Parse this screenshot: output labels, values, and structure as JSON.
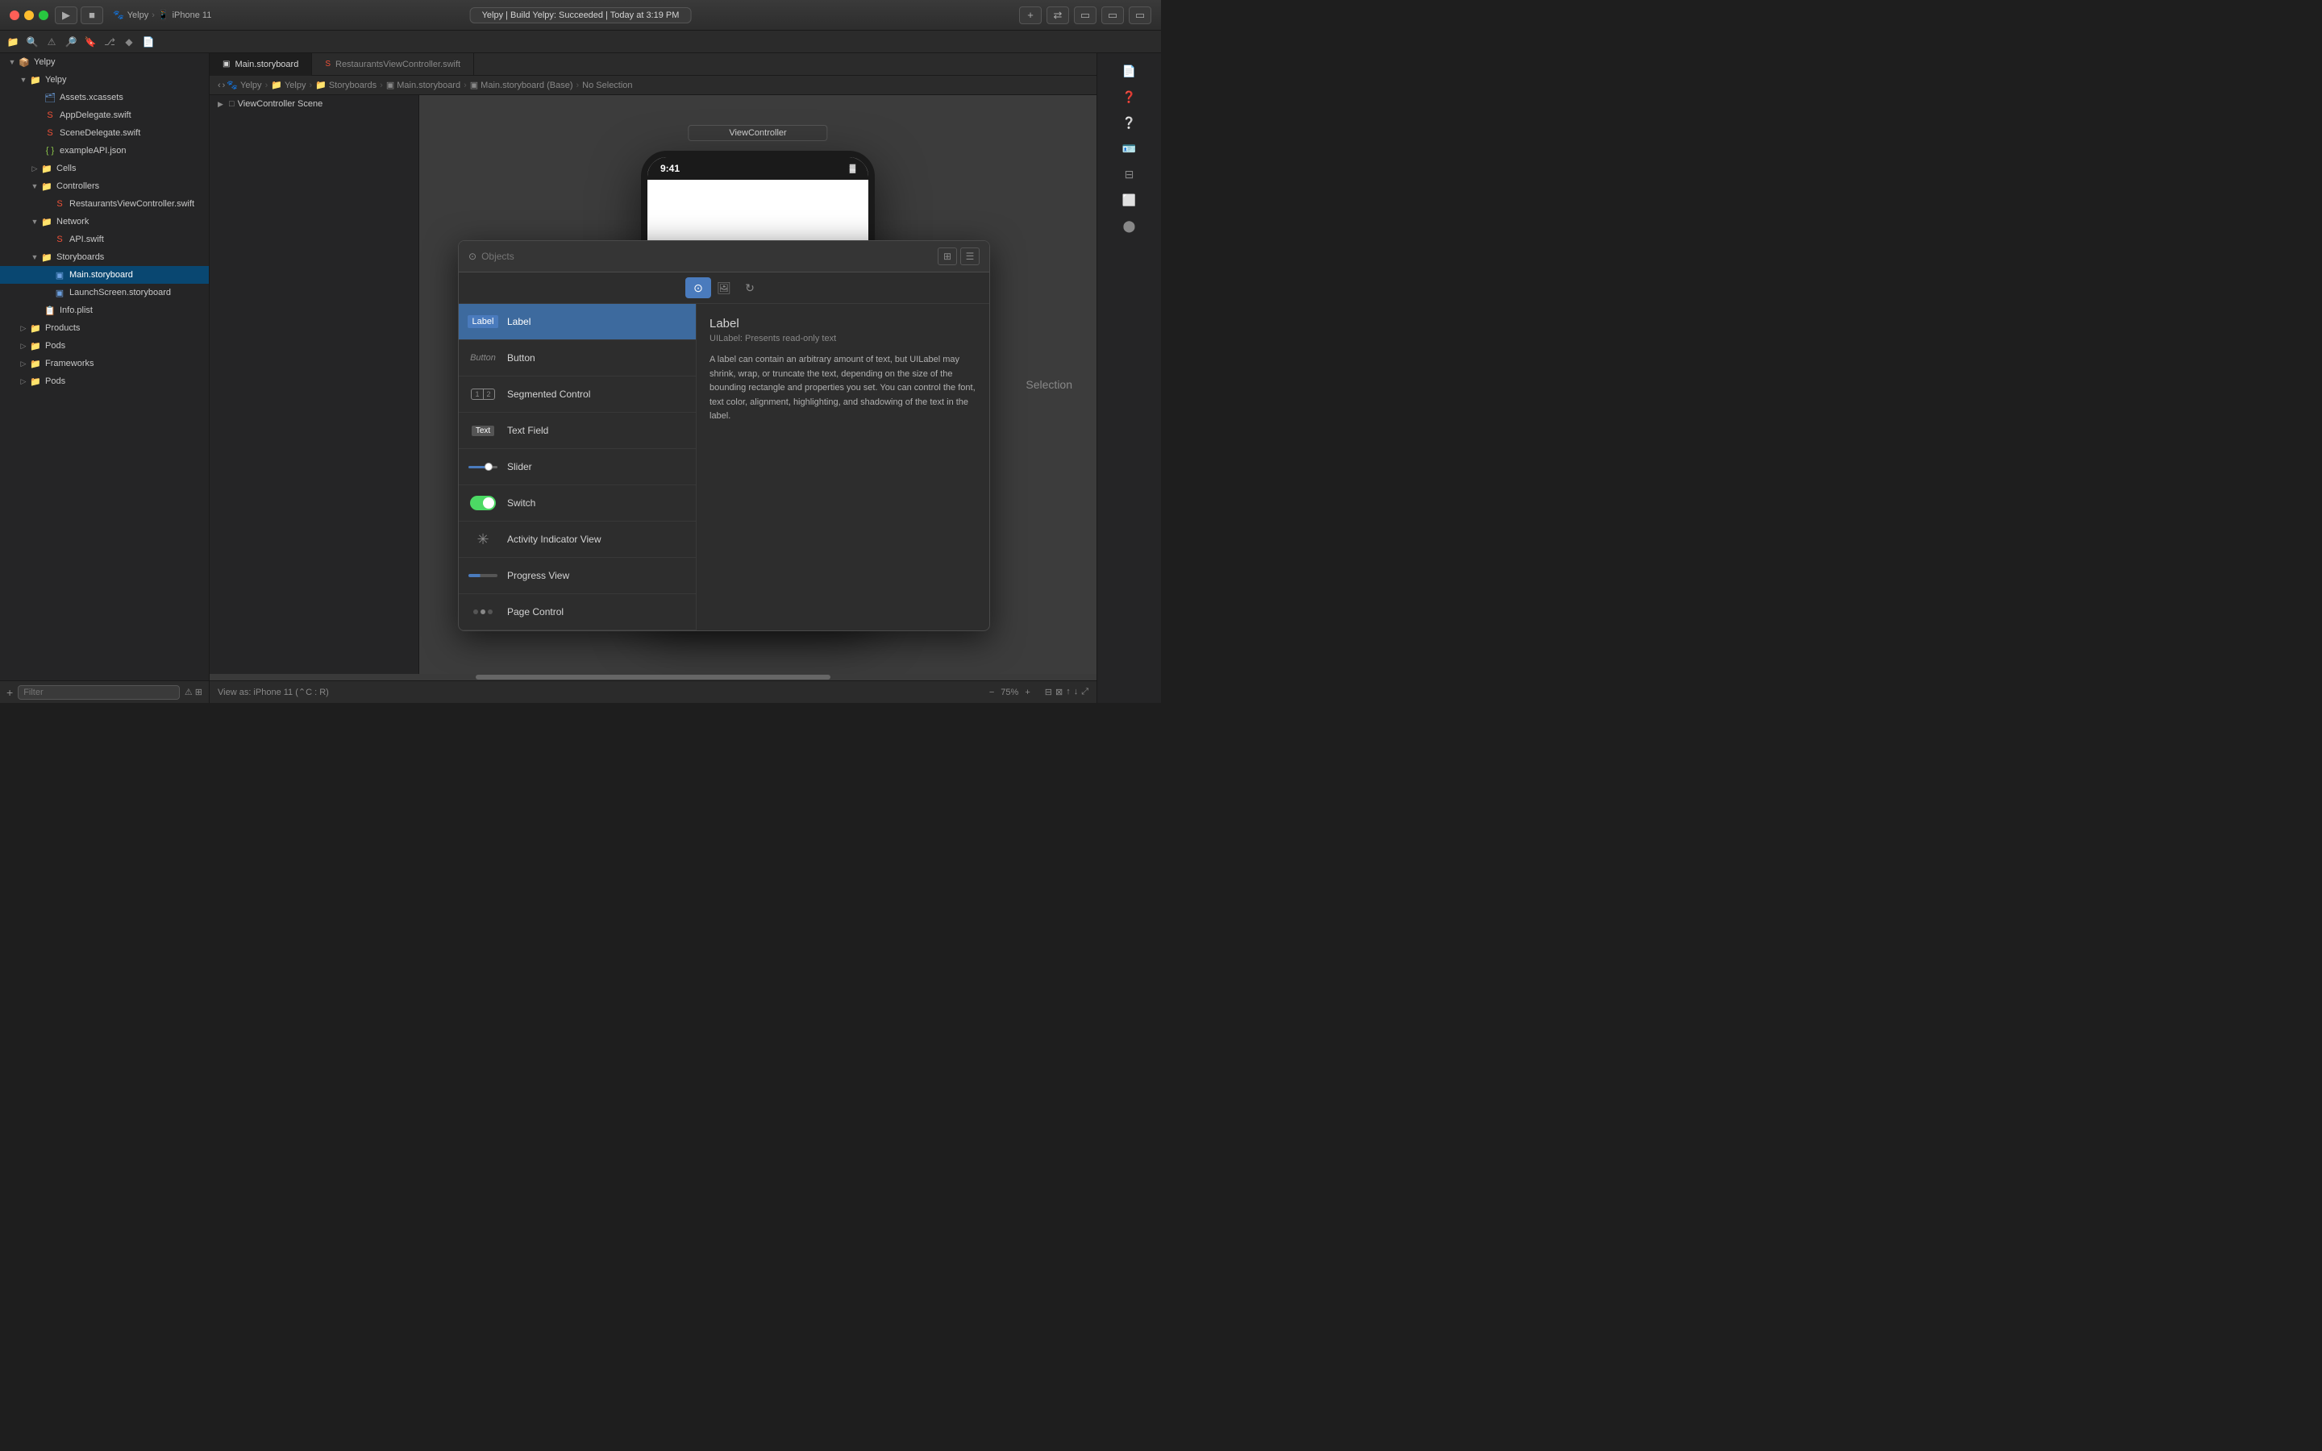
{
  "titleBar": {
    "appName": "Yelpy",
    "deviceName": "iPhone 11",
    "buildStatus": "Yelpy | Build Yelpy: Succeeded | Today at 3:19 PM"
  },
  "tabs": [
    {
      "id": "main-storyboard",
      "label": "Main.storyboard",
      "active": true
    },
    {
      "id": "restaurants-vc",
      "label": "RestaurantsViewController.swift",
      "active": false
    }
  ],
  "breadcrumb": {
    "items": [
      "Yelpy",
      "Yelpy",
      "Storyboards",
      "Main.storyboard",
      "Main.storyboard (Base)",
      "No Selection"
    ]
  },
  "sidebar": {
    "filterPlaceholder": "Filter",
    "items": [
      {
        "id": "yelpy-root",
        "label": "Yelpy",
        "type": "root",
        "indent": 0,
        "expanded": true
      },
      {
        "id": "yelpy-group",
        "label": "Yelpy",
        "type": "group",
        "indent": 1,
        "expanded": true
      },
      {
        "id": "assets",
        "label": "Assets.xcassets",
        "type": "file",
        "indent": 2
      },
      {
        "id": "appdelegate",
        "label": "AppDelegate.swift",
        "type": "swift",
        "indent": 2
      },
      {
        "id": "scenedelegate",
        "label": "SceneDelegate.swift",
        "type": "swift",
        "indent": 2
      },
      {
        "id": "exampleapi",
        "label": "exampleAPI.json",
        "type": "json",
        "indent": 2
      },
      {
        "id": "cells",
        "label": "Cells",
        "type": "group",
        "indent": 2,
        "expanded": false
      },
      {
        "id": "controllers",
        "label": "Controllers",
        "type": "group",
        "indent": 2,
        "expanded": true
      },
      {
        "id": "restaurants-vc-file",
        "label": "RestaurantsViewController.swift",
        "type": "swift",
        "indent": 3
      },
      {
        "id": "network",
        "label": "Network",
        "type": "group",
        "indent": 2,
        "expanded": true
      },
      {
        "id": "api",
        "label": "API.swift",
        "type": "swift",
        "indent": 3
      },
      {
        "id": "storyboards",
        "label": "Storyboards",
        "type": "group",
        "indent": 2,
        "expanded": true
      },
      {
        "id": "main-storyboard-file",
        "label": "Main.storyboard",
        "type": "storyboard",
        "indent": 3,
        "selected": true
      },
      {
        "id": "launchscreen",
        "label": "LaunchScreen.storyboard",
        "type": "storyboard",
        "indent": 3
      },
      {
        "id": "infoplist",
        "label": "Info.plist",
        "type": "plist",
        "indent": 2
      },
      {
        "id": "products",
        "label": "Products",
        "type": "group",
        "indent": 1,
        "expanded": false
      },
      {
        "id": "pods",
        "label": "Pods",
        "type": "group",
        "indent": 1,
        "expanded": false
      },
      {
        "id": "frameworks",
        "label": "Frameworks",
        "type": "group",
        "indent": 1,
        "expanded": false
      },
      {
        "id": "pods2",
        "label": "Pods",
        "type": "group",
        "indent": 1,
        "expanded": false
      }
    ]
  },
  "sceneOutline": {
    "items": [
      {
        "id": "scene",
        "label": "ViewController Scene",
        "indent": 0,
        "expanded": true,
        "arrow": "▶"
      }
    ]
  },
  "canvas": {
    "deviceLabel": "ViewController",
    "deviceTime": "9:41",
    "zoomLabel": "View as: iPhone 11 (⌃C : R)",
    "zoomLevel": "75%"
  },
  "objectsPanel": {
    "searchPlaceholder": "Objects",
    "tabs": [
      {
        "id": "objects",
        "icon": "⊙",
        "active": true
      },
      {
        "id": "images",
        "icon": "🖼",
        "active": false
      },
      {
        "id": "color",
        "icon": "↻",
        "active": false
      }
    ],
    "items": [
      {
        "id": "label",
        "name": "Label",
        "iconType": "label",
        "selected": true
      },
      {
        "id": "button",
        "name": "Button",
        "iconType": "button"
      },
      {
        "id": "segmented",
        "name": "Segmented Control",
        "iconType": "segmented"
      },
      {
        "id": "textfield",
        "name": "Text Field",
        "iconType": "textfield"
      },
      {
        "id": "slider",
        "name": "Slider",
        "iconType": "slider"
      },
      {
        "id": "switch",
        "name": "Switch",
        "iconType": "switch"
      },
      {
        "id": "activity",
        "name": "Activity Indicator View",
        "iconType": "activity"
      },
      {
        "id": "progress",
        "name": "Progress View",
        "iconType": "progress"
      },
      {
        "id": "pagecontrol",
        "name": "Page Control",
        "iconType": "pagecontrol"
      }
    ],
    "selectedItem": {
      "title": "Label",
      "subtitle": "UILabel: Presents read-only text",
      "description": "A label can contain an arbitrary amount of text, but UILabel may shrink, wrap, or truncate the text, depending on the size of the bounding rectangle and properties you set. You can control the font, text color, alignment, highlighting, and shadowing of the text in the label."
    }
  },
  "bottomBar": {
    "addLabel": "+",
    "filterLabel": "Filter"
  }
}
